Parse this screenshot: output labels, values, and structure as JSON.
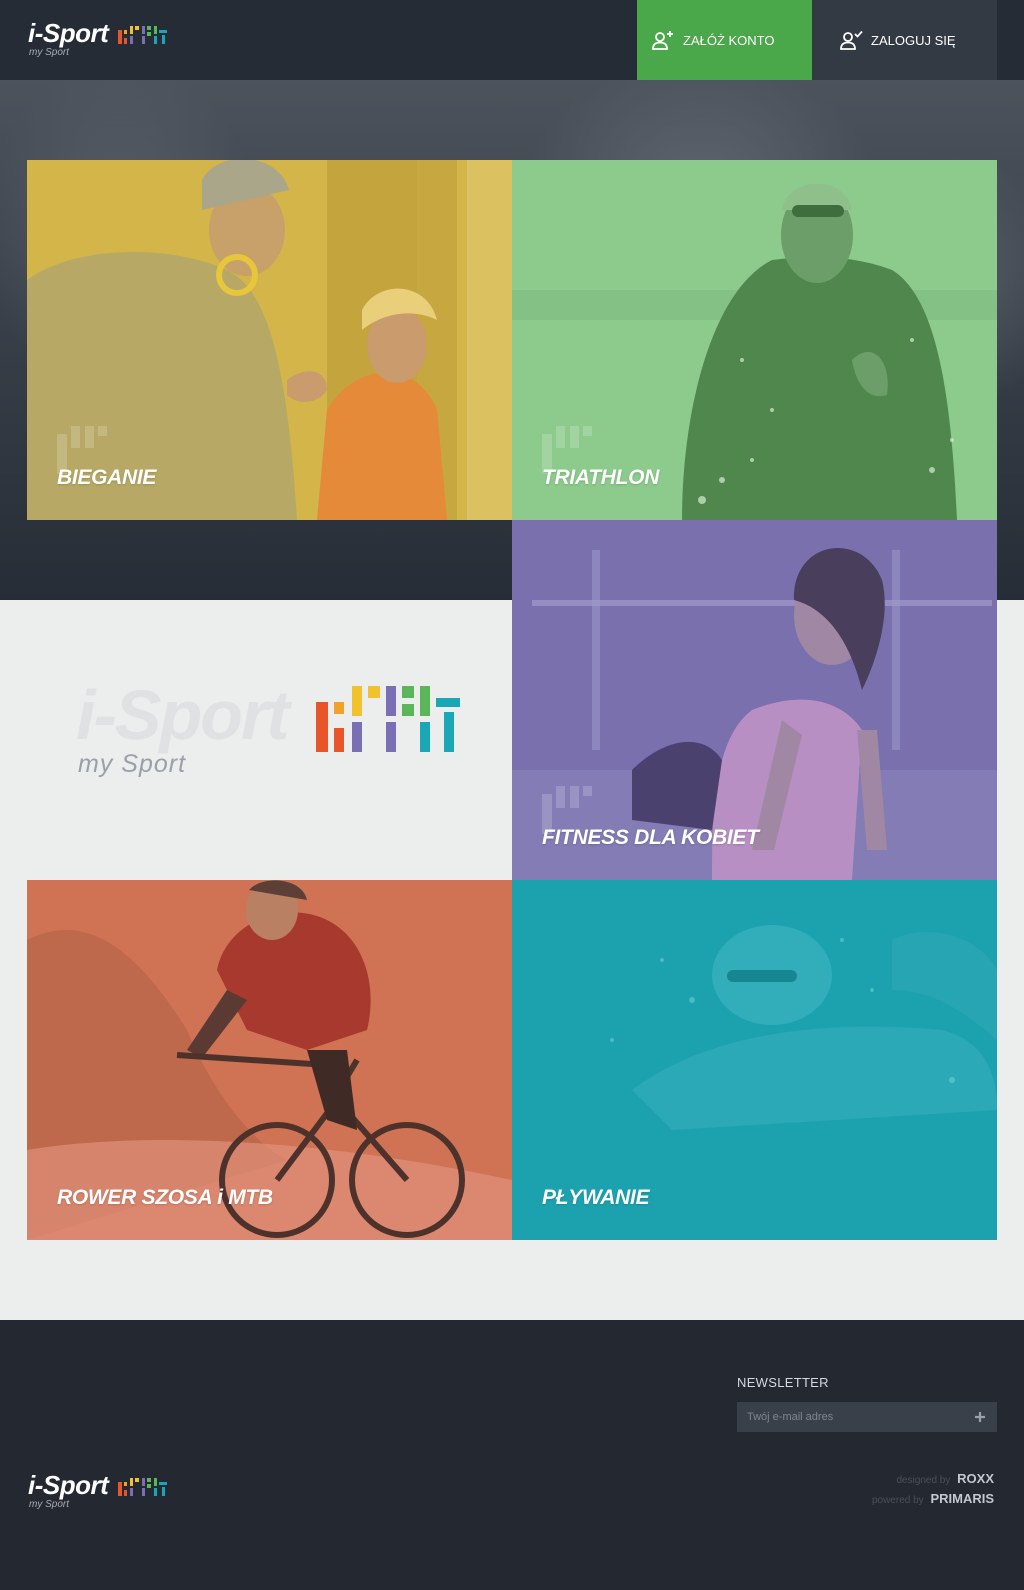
{
  "header": {
    "logo": {
      "word": "i-Sport",
      "tagline": "my Sport"
    },
    "register_label": "ZAŁÓŻ KONTO",
    "login_label": "ZALOGUJ SIĘ"
  },
  "tiles": [
    {
      "label": "BIEGANIE"
    },
    {
      "label": "TRIATHLON"
    },
    {
      "label": "FITNESS DLA KOBIET"
    },
    {
      "label": "ROWER SZOSA i MTB"
    },
    {
      "label": "PŁYWANIE"
    }
  ],
  "brand_block": {
    "word": "i-Sport",
    "tagline": "my Sport"
  },
  "footer": {
    "newsletter_title": "NEWSLETTER",
    "newsletter_placeholder": "Twój e-mail adres",
    "logo": {
      "word": "i-Sport",
      "tagline": "my Sport"
    },
    "designed_by_label": "designed by",
    "designed_by": "ROXX",
    "powered_by_label": "powered by",
    "powered_by": "PRIMARIS"
  },
  "colors": {
    "header_bg": "#262c36",
    "register_green": "#4aa84a",
    "running": "#d3b54a",
    "triathlon": "#8ccb8c",
    "fitness": "#7970ad",
    "bike": "#cf7354",
    "swim": "#1ea7b5",
    "footer_bg": "#232831"
  },
  "icons": {
    "register": "user-plus-icon",
    "login": "user-check-icon",
    "newsletter_submit": "plus-icon",
    "brand_mark": "isport-bars-logo-icon"
  }
}
